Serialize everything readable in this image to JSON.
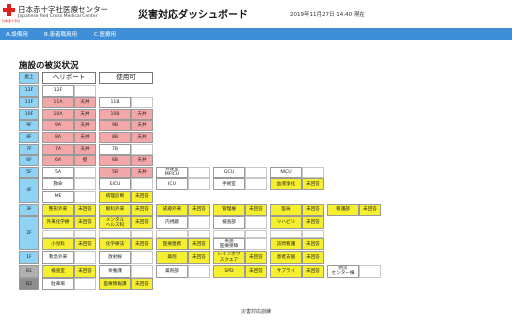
{
  "header": {
    "org_jp": "日本赤十字社医療センター",
    "org_en": "Japanese Red Cross Medical Center",
    "logo_sub": "日本赤十字社",
    "title": "災害対応ダッシュボード",
    "datetime": "2019年11月27日 14:40 現在"
  },
  "nav": [
    {
      "label": "A.設備用"
    },
    {
      "label": "B.患者職員用"
    },
    {
      "label": "C.医療用"
    }
  ],
  "section_title": "施設の被災状況",
  "colors": {
    "blue": "#8fd3f4",
    "pink": "#f4a7a9",
    "yellow": "#f6ef2f",
    "gray": "#b0b0b0",
    "nav": "#3f8fd8"
  },
  "grid": {
    "cells": [
      {
        "t": "屋上",
        "k": "blue",
        "c": 0,
        "r": 0
      },
      {
        "t": "ヘリポート",
        "k": "head",
        "c": 1,
        "r": 0,
        "w": 2
      },
      {
        "t": "使用可",
        "k": "head",
        "c": 3,
        "r": 0,
        "w": 2
      },
      {
        "t": "12F",
        "k": "blue",
        "c": 0,
        "r": 1
      },
      {
        "t": "12F",
        "k": "white",
        "c": 1,
        "r": 1
      },
      {
        "t": "",
        "k": "empty",
        "c": 2,
        "r": 1
      },
      {
        "t": "11F",
        "k": "blue",
        "c": 0,
        "r": 2
      },
      {
        "t": "11A",
        "k": "pink",
        "c": 1,
        "r": 2
      },
      {
        "t": "天井",
        "k": "pink",
        "c": 2,
        "r": 2
      },
      {
        "t": "11B",
        "k": "white",
        "c": 3,
        "r": 2
      },
      {
        "t": "",
        "k": "empty",
        "c": 4,
        "r": 2
      },
      {
        "t": "10F",
        "k": "blue",
        "c": 0,
        "r": 3
      },
      {
        "t": "10A",
        "k": "pink",
        "c": 1,
        "r": 3
      },
      {
        "t": "天井",
        "k": "pink",
        "c": 2,
        "r": 3
      },
      {
        "t": "10B",
        "k": "pink",
        "c": 3,
        "r": 3
      },
      {
        "t": "天井",
        "k": "pink",
        "c": 4,
        "r": 3
      },
      {
        "t": "9F",
        "k": "blue",
        "c": 0,
        "r": 4
      },
      {
        "t": "9A",
        "k": "pink",
        "c": 1,
        "r": 4
      },
      {
        "t": "天井",
        "k": "pink",
        "c": 2,
        "r": 4
      },
      {
        "t": "9B",
        "k": "pink",
        "c": 3,
        "r": 4
      },
      {
        "t": "天井",
        "k": "pink",
        "c": 4,
        "r": 4
      },
      {
        "t": "8F",
        "k": "blue",
        "c": 0,
        "r": 5
      },
      {
        "t": "8A",
        "k": "pink",
        "c": 1,
        "r": 5
      },
      {
        "t": "天井",
        "k": "pink",
        "c": 2,
        "r": 5
      },
      {
        "t": "8B",
        "k": "pink",
        "c": 3,
        "r": 5
      },
      {
        "t": "天井",
        "k": "pink",
        "c": 4,
        "r": 5
      },
      {
        "t": "7F",
        "k": "blue",
        "c": 0,
        "r": 6
      },
      {
        "t": "7A",
        "k": "pink",
        "c": 1,
        "r": 6
      },
      {
        "t": "天井",
        "k": "pink",
        "c": 2,
        "r": 6
      },
      {
        "t": "7B",
        "k": "white",
        "c": 3,
        "r": 6
      },
      {
        "t": "",
        "k": "empty",
        "c": 4,
        "r": 6
      },
      {
        "t": "6F",
        "k": "blue",
        "c": 0,
        "r": 7
      },
      {
        "t": "6A",
        "k": "pink",
        "c": 1,
        "r": 7
      },
      {
        "t": "壁",
        "k": "pink",
        "c": 2,
        "r": 7
      },
      {
        "t": "6B",
        "k": "pink",
        "c": 3,
        "r": 7
      },
      {
        "t": "天井",
        "k": "pink",
        "c": 4,
        "r": 7
      },
      {
        "t": "5F",
        "k": "blue",
        "c": 0,
        "r": 8
      },
      {
        "t": "5A",
        "k": "white",
        "c": 1,
        "r": 8
      },
      {
        "t": "",
        "k": "empty",
        "c": 2,
        "r": 8
      },
      {
        "t": "5B",
        "k": "pink",
        "c": 3,
        "r": 8
      },
      {
        "t": "天井",
        "k": "pink",
        "c": 4,
        "r": 8
      },
      {
        "t": "分娩室\nMFICU",
        "k": "white",
        "c": 5,
        "r": 8
      },
      {
        "t": "",
        "k": "empty",
        "c": 6,
        "r": 8
      },
      {
        "t": "GCU",
        "k": "white",
        "c": 7,
        "r": 8
      },
      {
        "t": "",
        "k": "empty",
        "c": 8,
        "r": 8
      },
      {
        "t": "NICU",
        "k": "white",
        "c": 9,
        "r": 8
      },
      {
        "t": "",
        "k": "empty",
        "c": 10,
        "r": 8
      },
      {
        "t": "4F",
        "k": "blue",
        "c": 0,
        "r": 9,
        "h": 2
      },
      {
        "t": "救命",
        "k": "white",
        "c": 1,
        "r": 9
      },
      {
        "t": "",
        "k": "empty",
        "c": 2,
        "r": 9
      },
      {
        "t": "EICU",
        "k": "white",
        "c": 3,
        "r": 9
      },
      {
        "t": "",
        "k": "empty",
        "c": 4,
        "r": 9
      },
      {
        "t": "ICU",
        "k": "white",
        "c": 5,
        "r": 9
      },
      {
        "t": "",
        "k": "empty",
        "c": 6,
        "r": 9
      },
      {
        "t": "手術室",
        "k": "white",
        "c": 7,
        "r": 9
      },
      {
        "t": "",
        "k": "empty",
        "c": 8,
        "r": 9
      },
      {
        "t": "血液浄化",
        "k": "yellow",
        "c": 9,
        "r": 9
      },
      {
        "t": "未回答",
        "k": "yellow",
        "c": 10,
        "r": 9
      },
      {
        "t": "ME",
        "k": "white",
        "c": 1,
        "r": 10
      },
      {
        "t": "",
        "k": "empty",
        "c": 2,
        "r": 10
      },
      {
        "t": "病理診断",
        "k": "yellow",
        "c": 3,
        "r": 10
      },
      {
        "t": "未回答",
        "k": "yellow",
        "c": 4,
        "r": 10
      },
      {
        "t": "3F",
        "k": "blue",
        "c": 0,
        "r": 11
      },
      {
        "t": "整形外来",
        "k": "yellow",
        "c": 1,
        "r": 11
      },
      {
        "t": "未回答",
        "k": "yellow",
        "c": 2,
        "r": 11
      },
      {
        "t": "眼科外来",
        "k": "yellow",
        "c": 3,
        "r": 11
      },
      {
        "t": "未回答",
        "k": "yellow",
        "c": 4,
        "r": 11
      },
      {
        "t": "皮膚外来",
        "k": "yellow",
        "c": 5,
        "r": 11
      },
      {
        "t": "未回答",
        "k": "yellow",
        "c": 6,
        "r": 11
      },
      {
        "t": "管理棟",
        "k": "yellow",
        "c": 7,
        "r": 11
      },
      {
        "t": "未回答",
        "k": "yellow",
        "c": 8,
        "r": 11
      },
      {
        "t": "医局",
        "k": "yellow",
        "c": 9,
        "r": 11
      },
      {
        "t": "未回答",
        "k": "yellow",
        "c": 10,
        "r": 11
      },
      {
        "t": "看護部",
        "k": "yellow",
        "c": 11,
        "r": 11
      },
      {
        "t": "未回答",
        "k": "yellow",
        "c": 12,
        "r": 11
      },
      {
        "t": "2F",
        "k": "blue",
        "c": 0,
        "r": 12,
        "h": 3
      },
      {
        "t": "外来化学療",
        "k": "yellow",
        "c": 1,
        "r": 12
      },
      {
        "t": "未回答",
        "k": "yellow",
        "c": 2,
        "r": 12
      },
      {
        "t": "メンタル\nヘルス科",
        "k": "yellow",
        "c": 3,
        "r": 12
      },
      {
        "t": "未回答",
        "k": "yellow",
        "c": 4,
        "r": 12
      },
      {
        "t": "内視鏡",
        "k": "white",
        "c": 5,
        "r": 12
      },
      {
        "t": "",
        "k": "empty",
        "c": 6,
        "r": 12
      },
      {
        "t": "検査部",
        "k": "white",
        "c": 7,
        "r": 12
      },
      {
        "t": "",
        "k": "empty",
        "c": 8,
        "r": 12
      },
      {
        "t": "リハビリ",
        "k": "yellow",
        "c": 9,
        "r": 12
      },
      {
        "t": "未回答",
        "k": "yellow",
        "c": 10,
        "r": 12
      },
      {
        "t": "",
        "k": "empty",
        "c": 1,
        "r": 13
      },
      {
        "t": "",
        "k": "empty",
        "c": 2,
        "r": 13
      },
      {
        "t": "",
        "k": "empty",
        "c": 3,
        "r": 13
      },
      {
        "t": "",
        "k": "empty",
        "c": 4,
        "r": 13
      },
      {
        "t": "",
        "k": "empty",
        "c": 5,
        "r": 13
      },
      {
        "t": "",
        "k": "empty",
        "c": 6,
        "r": 13
      },
      {
        "t": "",
        "k": "empty",
        "c": 7,
        "r": 13
      },
      {
        "t": "",
        "k": "empty",
        "c": 8,
        "r": 13
      },
      {
        "t": "",
        "k": "empty",
        "c": 9,
        "r": 13
      },
      {
        "t": "",
        "k": "empty",
        "c": 10,
        "r": 13
      },
      {
        "t": "小児科",
        "k": "yellow",
        "c": 1,
        "r": 14
      },
      {
        "t": "未回答",
        "k": "yellow",
        "c": 2,
        "r": 14
      },
      {
        "t": "化学療法",
        "k": "yellow",
        "c": 3,
        "r": 14
      },
      {
        "t": "未回答",
        "k": "yellow",
        "c": 4,
        "r": 14
      },
      {
        "t": "医療連携",
        "k": "yellow",
        "c": 5,
        "r": 14
      },
      {
        "t": "未回答",
        "k": "yellow",
        "c": 6,
        "r": 14
      },
      {
        "t": "英語\n医療保障",
        "k": "white",
        "c": 7,
        "r": 14
      },
      {
        "t": "",
        "k": "empty",
        "c": 8,
        "r": 14
      },
      {
        "t": "訪問看護",
        "k": "yellow",
        "c": 9,
        "r": 14
      },
      {
        "t": "未回答",
        "k": "yellow",
        "c": 10,
        "r": 14
      },
      {
        "t": "1F",
        "k": "blue",
        "c": 0,
        "r": 15
      },
      {
        "t": "救急外来",
        "k": "white",
        "c": 1,
        "r": 15
      },
      {
        "t": "",
        "k": "empty",
        "c": 2,
        "r": 15
      },
      {
        "t": "放射線",
        "k": "white",
        "c": 3,
        "r": 15
      },
      {
        "t": "",
        "k": "empty",
        "c": 4,
        "r": 15
      },
      {
        "t": "薬剤",
        "k": "yellow",
        "c": 5,
        "r": 15
      },
      {
        "t": "未回答",
        "k": "yellow",
        "c": 6,
        "r": 15
      },
      {
        "t": "レインボウ\nスクエア",
        "k": "yellow",
        "c": 7,
        "r": 15
      },
      {
        "t": "未回答",
        "k": "yellow",
        "c": 8,
        "r": 15
      },
      {
        "t": "患者支援",
        "k": "yellow",
        "c": 9,
        "r": 15
      },
      {
        "t": "未回答",
        "k": "yellow",
        "c": 10,
        "r": 15
      },
      {
        "t": "B1",
        "k": "gray",
        "c": 0,
        "r": 16
      },
      {
        "t": "検査室",
        "k": "yellow",
        "c": 1,
        "r": 16
      },
      {
        "t": "未回答",
        "k": "yellow",
        "c": 2,
        "r": 16
      },
      {
        "t": "栄養課",
        "k": "white",
        "c": 3,
        "r": 16
      },
      {
        "t": "",
        "k": "empty",
        "c": 4,
        "r": 16
      },
      {
        "t": "薬剤部",
        "k": "white",
        "c": 5,
        "r": 16
      },
      {
        "t": "",
        "k": "empty",
        "c": 6,
        "r": 16
      },
      {
        "t": "SPD",
        "k": "yellow",
        "c": 7,
        "r": 16
      },
      {
        "t": "未回答",
        "k": "yellow",
        "c": 8,
        "r": 16
      },
      {
        "t": "サプライ",
        "k": "yellow",
        "c": 9,
        "r": 16
      },
      {
        "t": "未回答",
        "k": "yellow",
        "c": 10,
        "r": 16
      },
      {
        "t": "防災\nセンター棟",
        "k": "white",
        "c": 11,
        "r": 16
      },
      {
        "t": "",
        "k": "empty",
        "c": 12,
        "r": 16
      },
      {
        "t": "B2",
        "k": "darkgray",
        "c": 0,
        "r": 17
      },
      {
        "t": "駐車場",
        "k": "white",
        "c": 1,
        "r": 17
      },
      {
        "t": "",
        "k": "empty",
        "c": 2,
        "r": 17
      },
      {
        "t": "医療情報課",
        "k": "yellow",
        "c": 3,
        "r": 17
      },
      {
        "t": "未回答",
        "k": "yellow",
        "c": 4,
        "r": 17
      }
    ]
  },
  "footer": "災害対応訓練"
}
